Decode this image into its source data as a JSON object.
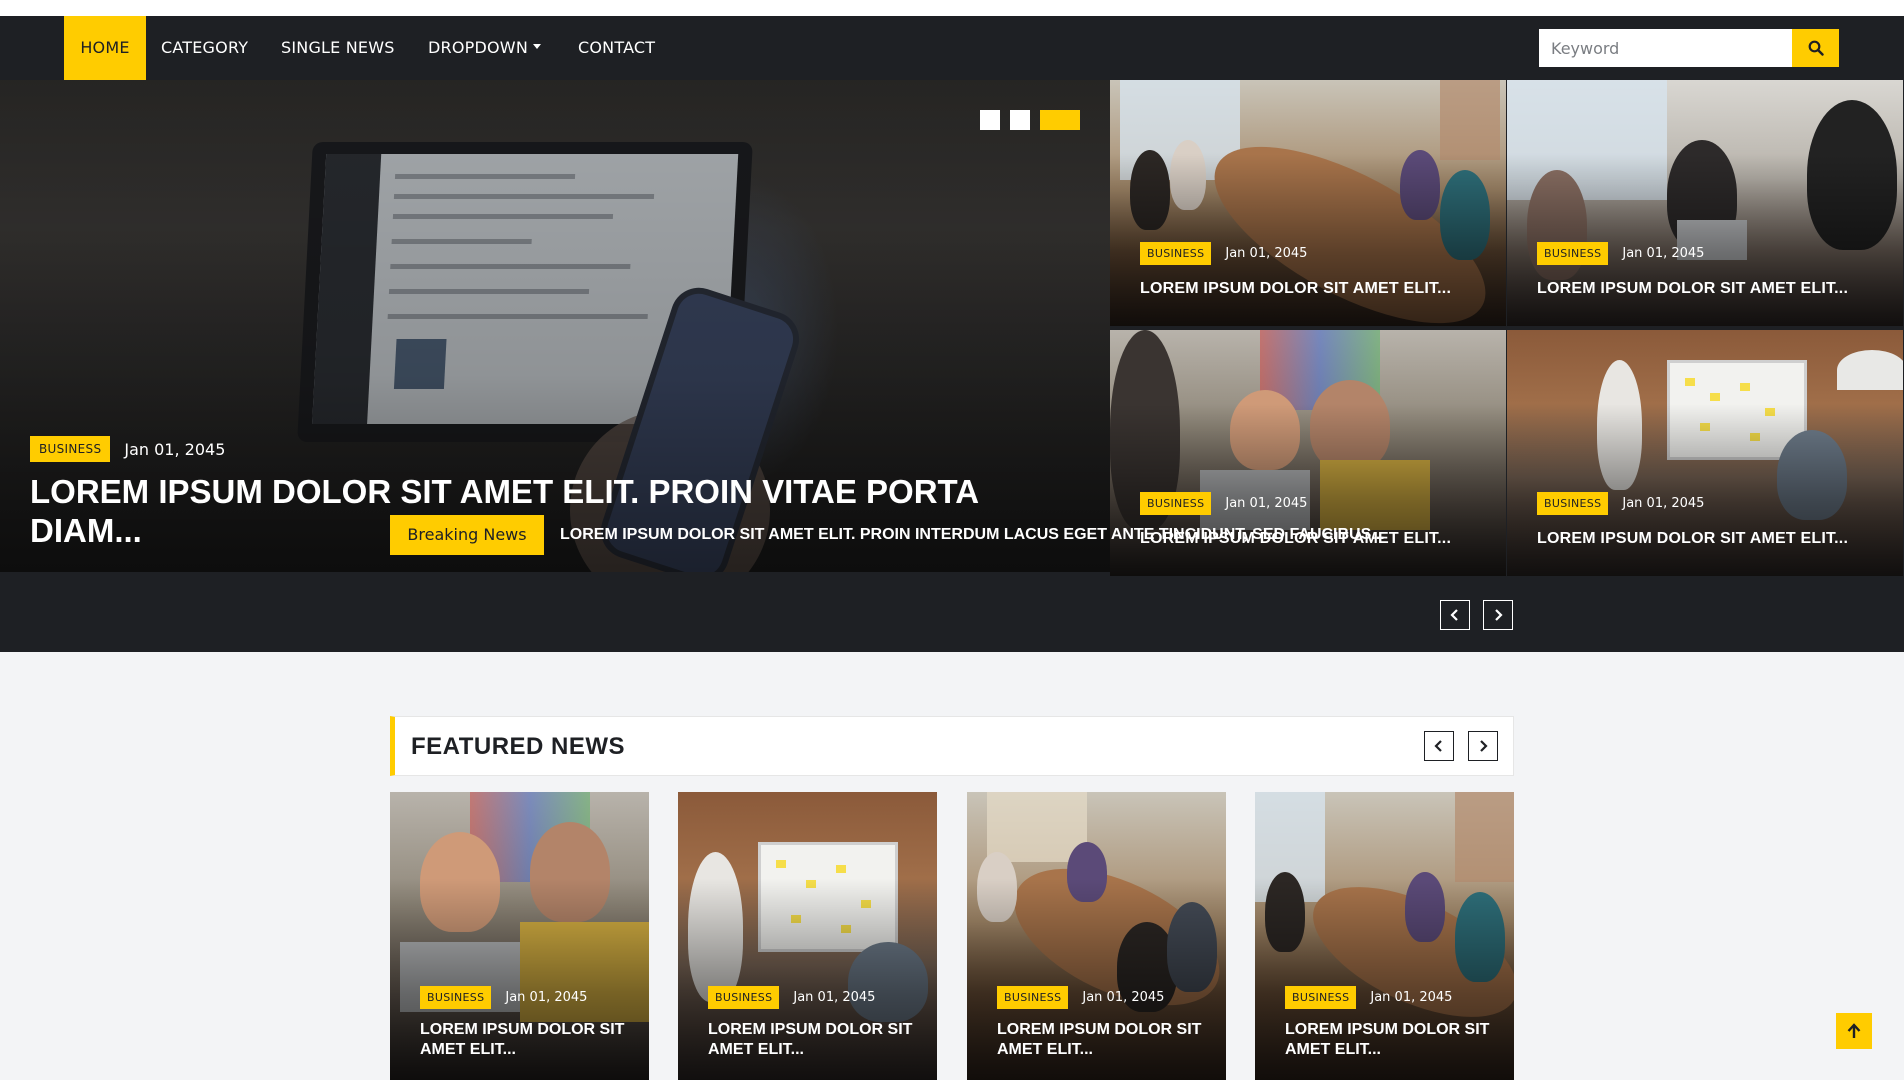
{
  "nav": {
    "items": [
      {
        "label": "HOME",
        "active": true
      },
      {
        "label": "CATEGORY",
        "active": false
      },
      {
        "label": "SINGLE NEWS",
        "active": false
      },
      {
        "label": "DROPDOWN",
        "active": false,
        "has_dropdown": true
      },
      {
        "label": "CONTACT",
        "active": false
      }
    ],
    "search": {
      "placeholder": "Keyword",
      "value": "",
      "button_icon": "search-icon"
    }
  },
  "hero": {
    "main": {
      "category": "BUSINESS",
      "date": "Jan 01, 2045",
      "title": "LOREM IPSUM DOLOR SIT AMET ELIT. PROIN VITAE PORTA DIAM..."
    },
    "carousel": {
      "slides": 3,
      "active_index": 2
    },
    "side_cards": [
      {
        "category": "BUSINESS",
        "date": "Jan 01, 2045",
        "title": "LOREM IPSUM DOLOR SIT AMET ELIT..."
      },
      {
        "category": "BUSINESS",
        "date": "Jan 01, 2045",
        "title": "LOREM IPSUM DOLOR SIT AMET ELIT..."
      },
      {
        "category": "BUSINESS",
        "date": "Jan 01, 2045",
        "title": "LOREM IPSUM DOLOR SIT AMET ELIT..."
      },
      {
        "category": "BUSINESS",
        "date": "Jan 01, 2045",
        "title": "LOREM IPSUM DOLOR SIT AMET ELIT..."
      }
    ]
  },
  "breaking": {
    "label": "Breaking News",
    "text": "LOREM IPSUM DOLOR SIT AMET ELIT. PROIN INTERDUM LACUS EGET ANTE TINCIDUNT, SED FAUCIBUS...",
    "prev_icon": "chevron-left-icon",
    "next_icon": "chevron-right-icon"
  },
  "featured": {
    "heading": "FEATURED NEWS",
    "cards": [
      {
        "category": "BUSINESS",
        "date": "Jan 01, 2045",
        "title": "LOREM IPSUM DOLOR SIT AMET ELIT..."
      },
      {
        "category": "BUSINESS",
        "date": "Jan 01, 2045",
        "title": "LOREM IPSUM DOLOR SIT AMET ELIT..."
      },
      {
        "category": "BUSINESS",
        "date": "Jan 01, 2045",
        "title": "LOREM IPSUM DOLOR SIT AMET ELIT..."
      },
      {
        "category": "BUSINESS",
        "date": "Jan 01, 2045",
        "title": "LOREM IPSUM DOLOR SIT AMET ELIT..."
      }
    ]
  },
  "back_to_top_icon": "arrow-up-icon",
  "colors": {
    "accent": "#ffcc00",
    "dark": "#1e2024",
    "background": "#f3f4f6"
  }
}
